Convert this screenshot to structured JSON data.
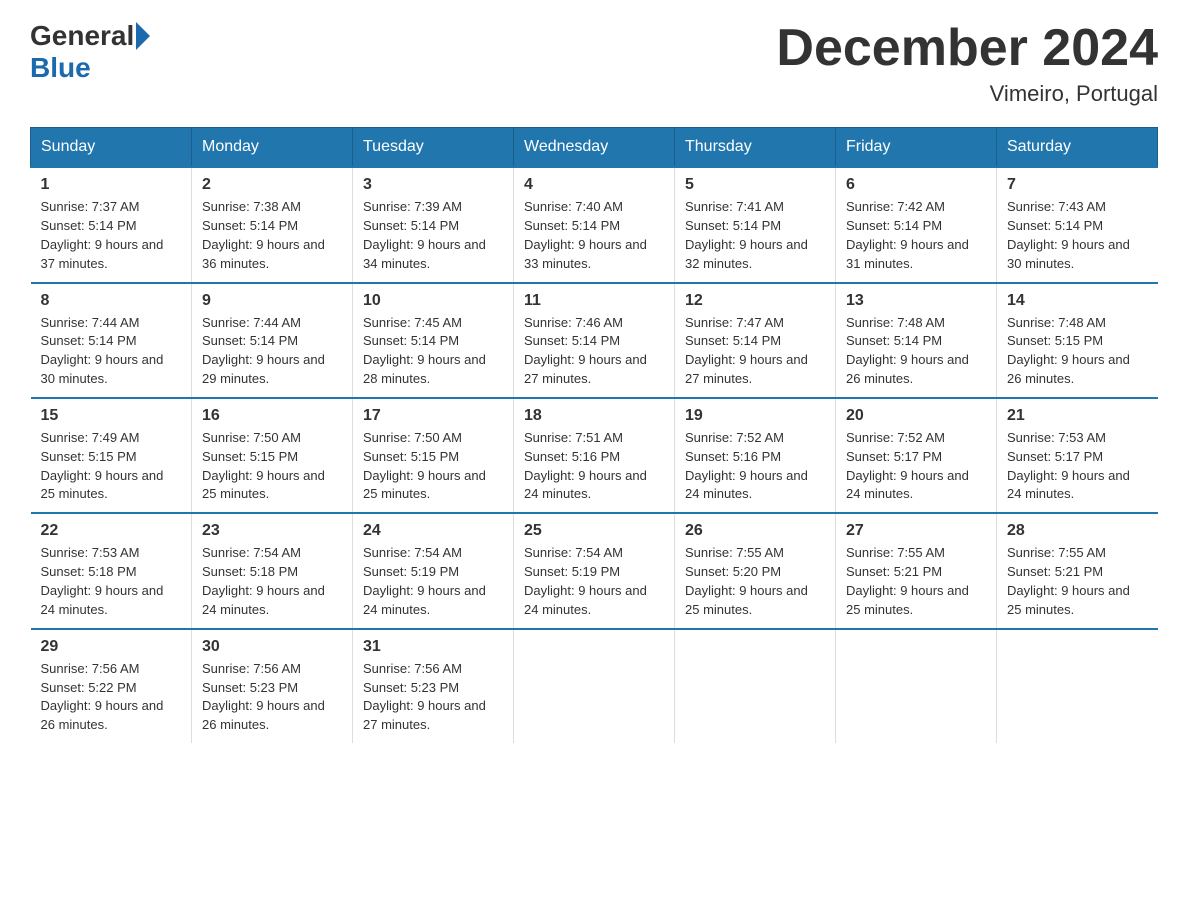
{
  "header": {
    "logo_general": "General",
    "logo_blue": "Blue",
    "month_year": "December 2024",
    "location": "Vimeiro, Portugal"
  },
  "days_of_week": [
    "Sunday",
    "Monday",
    "Tuesday",
    "Wednesday",
    "Thursday",
    "Friday",
    "Saturday"
  ],
  "weeks": [
    [
      {
        "day": "1",
        "sunrise": "7:37 AM",
        "sunset": "5:14 PM",
        "daylight": "9 hours and 37 minutes."
      },
      {
        "day": "2",
        "sunrise": "7:38 AM",
        "sunset": "5:14 PM",
        "daylight": "9 hours and 36 minutes."
      },
      {
        "day": "3",
        "sunrise": "7:39 AM",
        "sunset": "5:14 PM",
        "daylight": "9 hours and 34 minutes."
      },
      {
        "day": "4",
        "sunrise": "7:40 AM",
        "sunset": "5:14 PM",
        "daylight": "9 hours and 33 minutes."
      },
      {
        "day": "5",
        "sunrise": "7:41 AM",
        "sunset": "5:14 PM",
        "daylight": "9 hours and 32 minutes."
      },
      {
        "day": "6",
        "sunrise": "7:42 AM",
        "sunset": "5:14 PM",
        "daylight": "9 hours and 31 minutes."
      },
      {
        "day": "7",
        "sunrise": "7:43 AM",
        "sunset": "5:14 PM",
        "daylight": "9 hours and 30 minutes."
      }
    ],
    [
      {
        "day": "8",
        "sunrise": "7:44 AM",
        "sunset": "5:14 PM",
        "daylight": "9 hours and 30 minutes."
      },
      {
        "day": "9",
        "sunrise": "7:44 AM",
        "sunset": "5:14 PM",
        "daylight": "9 hours and 29 minutes."
      },
      {
        "day": "10",
        "sunrise": "7:45 AM",
        "sunset": "5:14 PM",
        "daylight": "9 hours and 28 minutes."
      },
      {
        "day": "11",
        "sunrise": "7:46 AM",
        "sunset": "5:14 PM",
        "daylight": "9 hours and 27 minutes."
      },
      {
        "day": "12",
        "sunrise": "7:47 AM",
        "sunset": "5:14 PM",
        "daylight": "9 hours and 27 minutes."
      },
      {
        "day": "13",
        "sunrise": "7:48 AM",
        "sunset": "5:14 PM",
        "daylight": "9 hours and 26 minutes."
      },
      {
        "day": "14",
        "sunrise": "7:48 AM",
        "sunset": "5:15 PM",
        "daylight": "9 hours and 26 minutes."
      }
    ],
    [
      {
        "day": "15",
        "sunrise": "7:49 AM",
        "sunset": "5:15 PM",
        "daylight": "9 hours and 25 minutes."
      },
      {
        "day": "16",
        "sunrise": "7:50 AM",
        "sunset": "5:15 PM",
        "daylight": "9 hours and 25 minutes."
      },
      {
        "day": "17",
        "sunrise": "7:50 AM",
        "sunset": "5:15 PM",
        "daylight": "9 hours and 25 minutes."
      },
      {
        "day": "18",
        "sunrise": "7:51 AM",
        "sunset": "5:16 PM",
        "daylight": "9 hours and 24 minutes."
      },
      {
        "day": "19",
        "sunrise": "7:52 AM",
        "sunset": "5:16 PM",
        "daylight": "9 hours and 24 minutes."
      },
      {
        "day": "20",
        "sunrise": "7:52 AM",
        "sunset": "5:17 PM",
        "daylight": "9 hours and 24 minutes."
      },
      {
        "day": "21",
        "sunrise": "7:53 AM",
        "sunset": "5:17 PM",
        "daylight": "9 hours and 24 minutes."
      }
    ],
    [
      {
        "day": "22",
        "sunrise": "7:53 AM",
        "sunset": "5:18 PM",
        "daylight": "9 hours and 24 minutes."
      },
      {
        "day": "23",
        "sunrise": "7:54 AM",
        "sunset": "5:18 PM",
        "daylight": "9 hours and 24 minutes."
      },
      {
        "day": "24",
        "sunrise": "7:54 AM",
        "sunset": "5:19 PM",
        "daylight": "9 hours and 24 minutes."
      },
      {
        "day": "25",
        "sunrise": "7:54 AM",
        "sunset": "5:19 PM",
        "daylight": "9 hours and 24 minutes."
      },
      {
        "day": "26",
        "sunrise": "7:55 AM",
        "sunset": "5:20 PM",
        "daylight": "9 hours and 25 minutes."
      },
      {
        "day": "27",
        "sunrise": "7:55 AM",
        "sunset": "5:21 PM",
        "daylight": "9 hours and 25 minutes."
      },
      {
        "day": "28",
        "sunrise": "7:55 AM",
        "sunset": "5:21 PM",
        "daylight": "9 hours and 25 minutes."
      }
    ],
    [
      {
        "day": "29",
        "sunrise": "7:56 AM",
        "sunset": "5:22 PM",
        "daylight": "9 hours and 26 minutes."
      },
      {
        "day": "30",
        "sunrise": "7:56 AM",
        "sunset": "5:23 PM",
        "daylight": "9 hours and 26 minutes."
      },
      {
        "day": "31",
        "sunrise": "7:56 AM",
        "sunset": "5:23 PM",
        "daylight": "9 hours and 27 minutes."
      },
      null,
      null,
      null,
      null
    ]
  ]
}
